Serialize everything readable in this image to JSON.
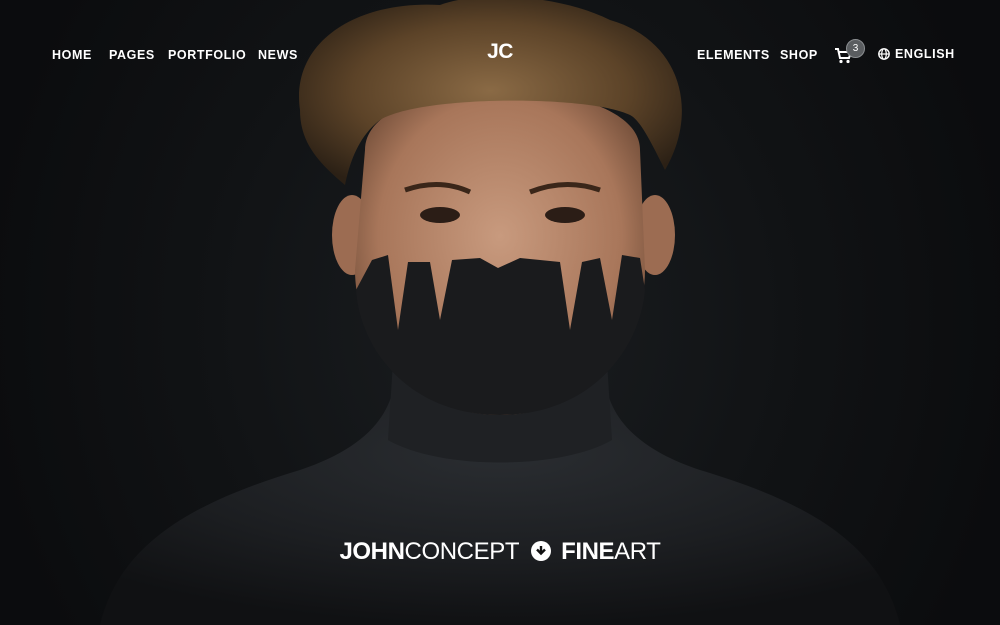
{
  "nav": {
    "left": [
      {
        "label": "HOME"
      },
      {
        "label": "PAGES"
      },
      {
        "label": "PORTFOLIO"
      },
      {
        "label": "NEWS"
      }
    ],
    "logo": "JC",
    "right": [
      {
        "label": "ELEMENTS"
      },
      {
        "label": "SHOP"
      }
    ],
    "cart": {
      "icon": "cart-icon",
      "count": "3"
    },
    "language": {
      "icon": "globe-icon",
      "label": "ENGLISH"
    }
  },
  "hero": {
    "tagline": {
      "part1_bold": "JOHN",
      "part1_light": "CONCEPT",
      "icon": "arrow-down-circle-icon",
      "part2_bold": "FINE",
      "part2_light": "ART"
    }
  },
  "colors": {
    "background": "#0e1012",
    "text": "#ffffff",
    "badge": "#5a5d60"
  }
}
